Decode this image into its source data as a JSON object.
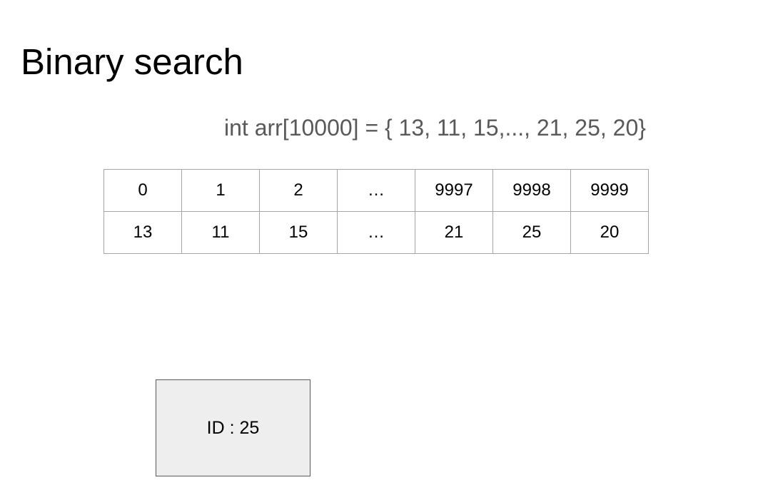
{
  "title": "Binary search",
  "code": "int arr[10000] = { 13, 11, 15,..., 21, 25, 20}",
  "array_table": {
    "indices": [
      "0",
      "1",
      "2",
      "…",
      "9997",
      "9998",
      "9999"
    ],
    "values": [
      "13",
      "11",
      "15",
      "…",
      "21",
      "25",
      "20"
    ]
  },
  "target": {
    "label": "ID : 25"
  },
  "colors": {
    "code_text": "#595959",
    "table_border": "#a6a6a6",
    "box_fill": "#eeeeee",
    "box_border": "#595959"
  }
}
